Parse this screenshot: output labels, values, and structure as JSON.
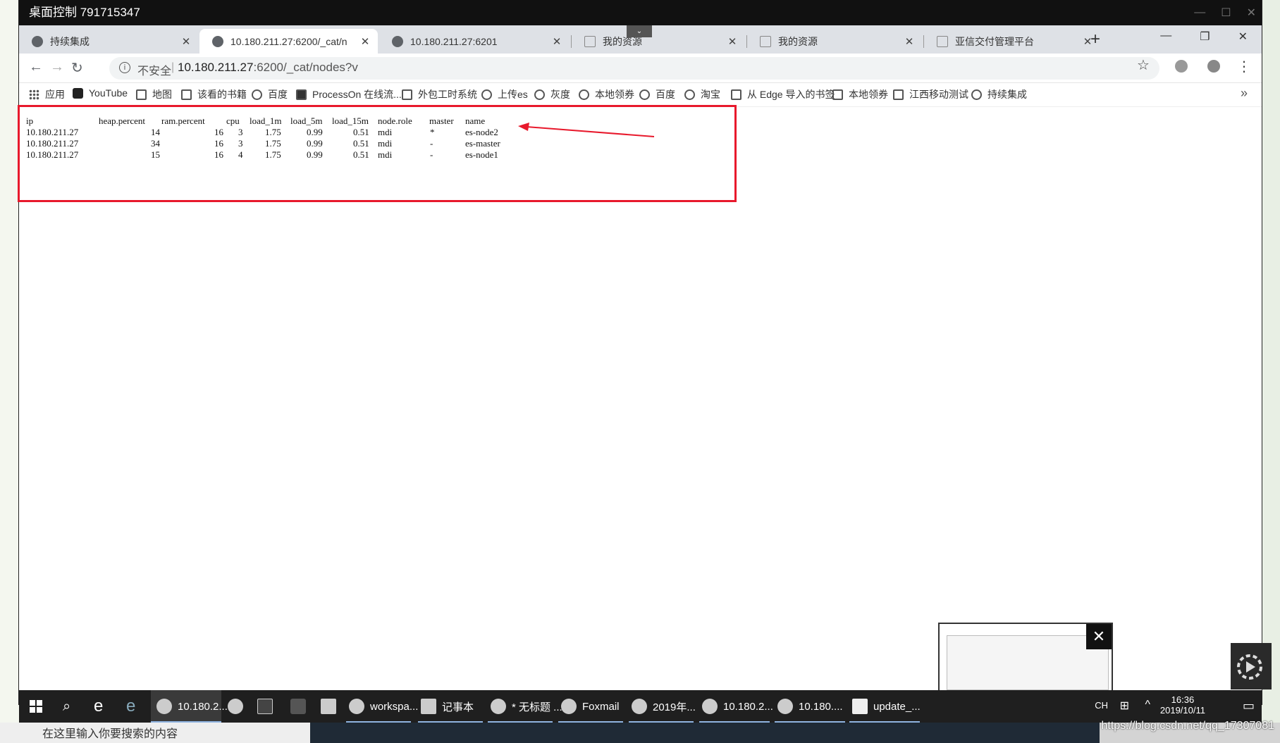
{
  "remote_window": {
    "title": "桌面控制 791715347"
  },
  "tabs": [
    {
      "label": "持续集成",
      "icon": "globe-icon"
    },
    {
      "label": "10.180.211.27:6200/_cat/n",
      "icon": "elastic-icon"
    },
    {
      "label": "10.180.211.27:6201",
      "icon": "elastic-icon"
    },
    {
      "label": "我的资源",
      "icon": "doc-icon"
    },
    {
      "label": "我的资源",
      "icon": "doc-icon"
    },
    {
      "label": "亚信交付管理平台",
      "icon": "doc-icon"
    }
  ],
  "toolbar": {
    "insecure_label": "不安全",
    "url_host": "10.180.211.27",
    "url_rest": ":6200/_cat/nodes?v"
  },
  "bookmarks": [
    "应用",
    "YouTube",
    "地图",
    "该看的书籍",
    "百度",
    "ProcessOn 在线流...",
    "外包工时系统",
    "上传es",
    "灰度",
    "本地领券",
    "百度",
    "淘宝",
    "从 Edge 导入的书签",
    "本地领券",
    "江西移动测试",
    "持续集成"
  ],
  "cat_nodes": {
    "headers": [
      "ip",
      "heap.percent",
      "ram.percent",
      "cpu",
      "load_1m",
      "load_5m",
      "load_15m",
      "node.role",
      "master",
      "name"
    ],
    "rows": [
      [
        "10.180.211.27",
        "14",
        "16",
        "3",
        "1.75",
        "0.99",
        "0.51",
        "mdi",
        "*",
        "es-node2"
      ],
      [
        "10.180.211.27",
        "34",
        "16",
        "3",
        "1.75",
        "0.99",
        "0.51",
        "mdi",
        "-",
        "es-master"
      ],
      [
        "10.180.211.27",
        "15",
        "16",
        "4",
        "1.75",
        "0.99",
        "0.51",
        "mdi",
        "-",
        "es-node1"
      ]
    ]
  },
  "taskbar": {
    "items": [
      "10.180.2...",
      "workspa...",
      "记事本",
      "* 无标题 ...",
      "Foxmail",
      "2019年...",
      "10.180.2...",
      "10.180....",
      "update_..."
    ],
    "ime": "CH",
    "time": "16:36",
    "date": "2019/10/11"
  },
  "local": {
    "search_placeholder": "在这里输入你要搜索的内容",
    "watermark": "https://blog.csdn.net/qq_17307081",
    "time": "16:36"
  },
  "colors": {
    "highlight": "#e8192c",
    "taskbar": "#1f1f1f",
    "tabstrip": "#dee1e6"
  }
}
